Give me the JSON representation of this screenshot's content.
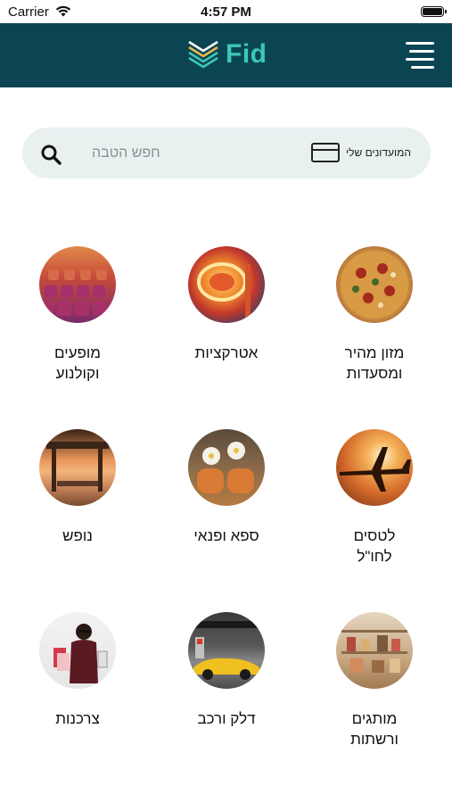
{
  "status_bar": {
    "carrier": "Carrier",
    "time": "4:57 PM"
  },
  "header": {
    "logo_text": "Fid"
  },
  "search": {
    "placeholder": "חפש הטבה",
    "clubs_label": "המועדונים שלי"
  },
  "categories": [
    {
      "label": "מזון מהיר\nומסעדות",
      "icon": "pizza-icon"
    },
    {
      "label": "אטרקציות",
      "icon": "amusement-ride-icon"
    },
    {
      "label": "מופעים\nוקולנוע",
      "icon": "theater-seats-icon"
    },
    {
      "label": "לטסים\nלחו\"ל",
      "icon": "airplane-icon"
    },
    {
      "label": "ספא ופנאי",
      "icon": "spa-towels-icon"
    },
    {
      "label": "נופש",
      "icon": "beach-gazebo-icon"
    },
    {
      "label": "מותגים\nורשתות",
      "icon": "store-shelves-icon"
    },
    {
      "label": "דלק ורכב",
      "icon": "gas-station-car-icon"
    },
    {
      "label": "צרכנות",
      "icon": "shopping-woman-icon"
    }
  ],
  "colors": {
    "header_bg": "#0c4552",
    "logo_accent": "#3cc8b4",
    "search_bg": "#e8f0f0"
  }
}
